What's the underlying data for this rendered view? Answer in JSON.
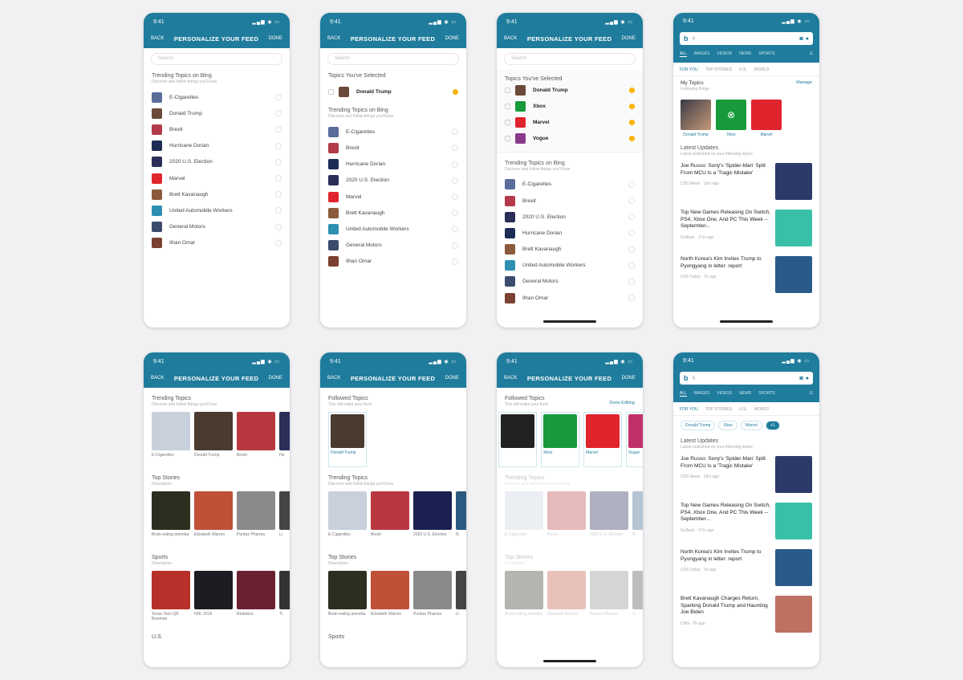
{
  "colors": {
    "brand": "#1f7c9c",
    "accent": "#f5b400"
  },
  "header": {
    "time": "9:41",
    "back": "BACK",
    "title": "PERSONALIZE YOUR FEED",
    "done": "DONE"
  },
  "search_placeholder": "Search",
  "trending": {
    "title": "Trending Topics on Bing",
    "subtitle": "Discover and follow things you'll love"
  },
  "selected_title": "Topics You've Selected",
  "topics": [
    {
      "label": "E-Cigarettes",
      "color": "#5a6c9a"
    },
    {
      "label": "Donald Trump",
      "color": "#6b4a3a"
    },
    {
      "label": "Brexit",
      "color": "#b23a4a"
    },
    {
      "label": "Hurricane Dorian",
      "color": "#1d2c55"
    },
    {
      "label": "2020 U.S. Election",
      "color": "#2a2e59"
    },
    {
      "label": "Marvel",
      "color": "#e0242d"
    },
    {
      "label": "Brett Kavanaugh",
      "color": "#8a5a3a"
    },
    {
      "label": "United Automobile Workers",
      "color": "#2d8fb2"
    },
    {
      "label": "General Motors",
      "color": "#3c4a6e"
    },
    {
      "label": "Ilhan Omar",
      "color": "#7a4030"
    }
  ],
  "screen2_list": [
    "E-Cigarettes",
    "Brexit",
    "Hurricane Dorian",
    "2020 U.S. Election",
    "Marvel",
    "Brett Kavanaugh",
    "United Automobile Workers",
    "General Motors",
    "Ilhan Omar"
  ],
  "screen3": {
    "selected": [
      "Donald Trump",
      "Xbox",
      "Marvel",
      "Vogue"
    ],
    "list": [
      "E-Cigarettes",
      "Brexit",
      "2020 U.S. Election",
      "Hurricane Dorian",
      "Brett Kavanaugh",
      "United Automobile Workers",
      "General Motors",
      "Ilhan Omar"
    ]
  },
  "bing": {
    "query": "q",
    "scopes": [
      "ALL",
      "IMAGES",
      "VIDEOS",
      "NEWS",
      "SPORTS"
    ],
    "tabs": [
      "FOR YOU",
      "TOP STORIES",
      "U.S.",
      "WORLD"
    ],
    "my_topics": "My Topics",
    "my_topics_sub": "Following things",
    "manage": "Manage",
    "tiles": [
      "Donald Trump",
      "Xbox",
      "Marvel"
    ],
    "latest": "Latest Updates",
    "latest_sub": "Latest published on your following topics",
    "articles": [
      {
        "title": "Joe Russo: Sony's 'Spider-Man' Split From MCU Is a 'Tragic Mistake'",
        "meta": "CBS News · 16m ago"
      },
      {
        "title": "Top New Games Releasing On Switch, PS4, Xbox One, And PC This Week -- September...",
        "meta": "GoBack · 27m ago"
      },
      {
        "title": "North Korea's Kim Invites Trump to Pyongyang in letter: report",
        "meta": "USA Today · 1h ago"
      },
      {
        "title": "Brett Kavanaugh Charges Return, Sparking Donald Trump and Haunting Joe Biden",
        "meta": "CNN · 2h ago"
      }
    ],
    "chips": [
      "Donald Trump",
      "Xbox",
      "Marvel",
      "+1"
    ]
  },
  "row2": {
    "trending_title": "Trending Topics",
    "trending_sub": "Discover and follow things you'll love",
    "trending_cards": [
      "E-Cigarettes",
      "Donald Trump",
      "Brexit",
      "Hu"
    ],
    "top_stories": "Top Stories",
    "top_stories_sub": "Description",
    "story_cards": [
      "Brain-eating amoeba",
      "Elizabeth Warren",
      "Purdue Pharma",
      "Li"
    ],
    "sports": "Sports",
    "sports_sub": "Description",
    "sports_cards": [
      "Texas Tech QB Bowman",
      "NHL 2019",
      "Redskins",
      "Ti"
    ],
    "us": "U.S.",
    "followed_title": "Followed Topics",
    "followed_sub": "This will make your feed",
    "followed_cards": [
      "Donald Trump"
    ],
    "followed_cards_3": [
      "",
      "Xbox",
      "Marvel",
      "Vogue"
    ],
    "edit": "Done Editing",
    "trending_cards_6": [
      "E-Cigarettes",
      "Brexit",
      "2020 U.S. Election",
      "N"
    ],
    "stories_6": [
      "Brain-eating amoeba",
      "Elizabeth Warren",
      "Purdue Pharma",
      "Li"
    ],
    "sports_title_6": "Sports"
  }
}
